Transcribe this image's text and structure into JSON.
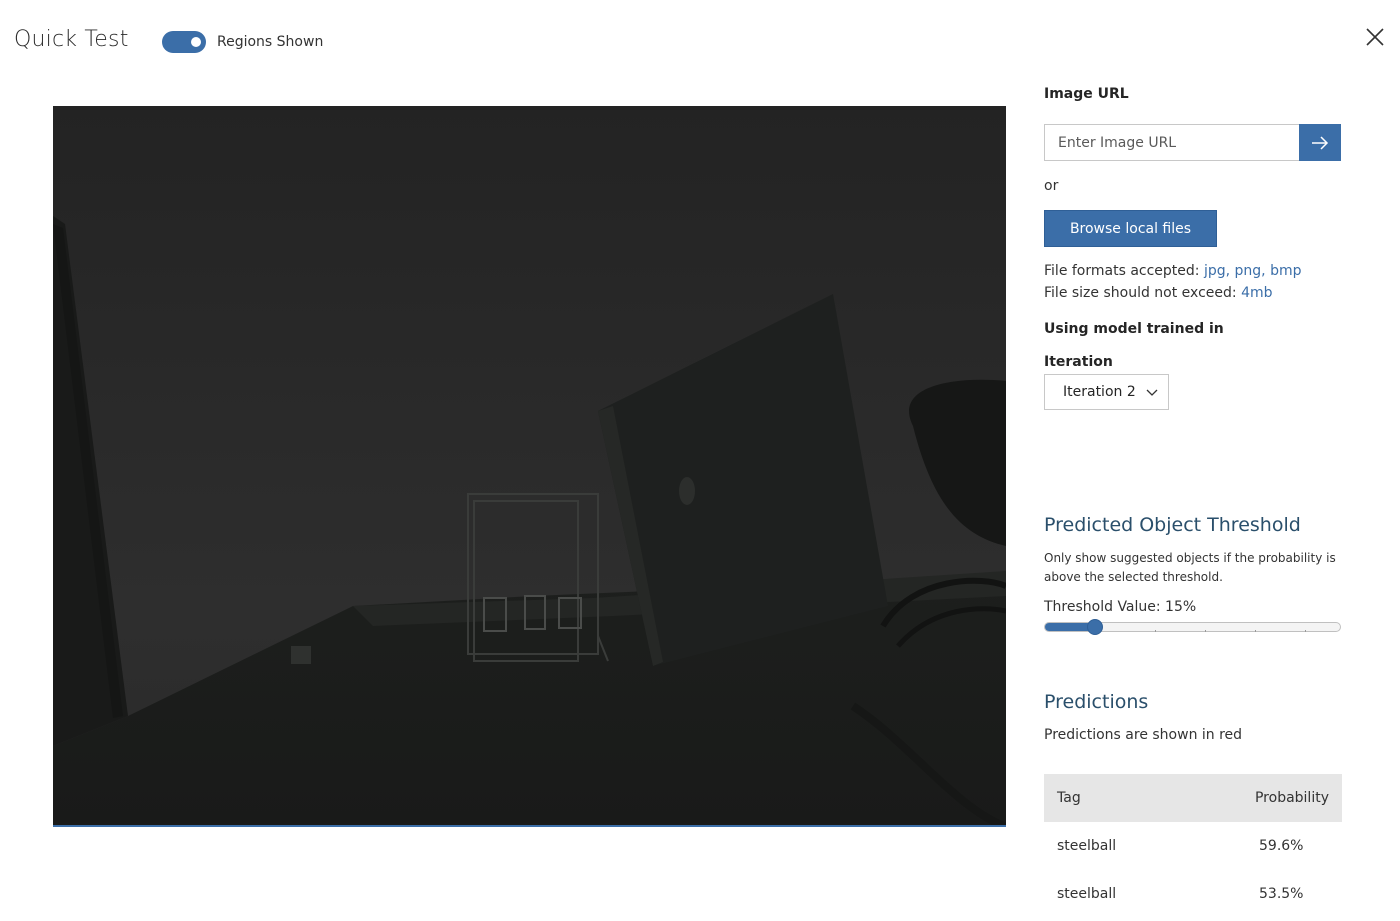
{
  "header": {
    "title": "Quick Test",
    "regions_toggle_label": "Regions Shown",
    "regions_toggle_on": true,
    "close_icon": "close-icon"
  },
  "image_url": {
    "label": "Image URL",
    "placeholder": "Enter Image URL",
    "submit_icon": "arrow-right-icon"
  },
  "upload": {
    "or_text": "or",
    "browse_label": "Browse local files",
    "formats_prefix": "File formats accepted: ",
    "formats": "jpg, png, bmp",
    "size_prefix": "File size should not exceed: ",
    "size_limit": "4mb"
  },
  "model": {
    "trained_in_label": "Using model trained in",
    "iteration_label": "Iteration",
    "iteration_selected": "Iteration 2",
    "chevron_icon": "chevron-down-icon"
  },
  "threshold": {
    "title": "Predicted Object Threshold",
    "description": "Only show suggested objects if the probability is above the selected threshold.",
    "value_label": "Threshold Value: 15%",
    "value_percent": 15
  },
  "predictions": {
    "title": "Predictions",
    "subtitle": "Predictions are shown in red",
    "columns": [
      "Tag",
      "Probability"
    ],
    "rows": [
      {
        "tag": "steelball",
        "probability": "59.6%"
      },
      {
        "tag": "steelball",
        "probability": "53.5%"
      }
    ]
  },
  "colors": {
    "accent": "#3b6ea8",
    "section_title": "#2a4f6b"
  }
}
